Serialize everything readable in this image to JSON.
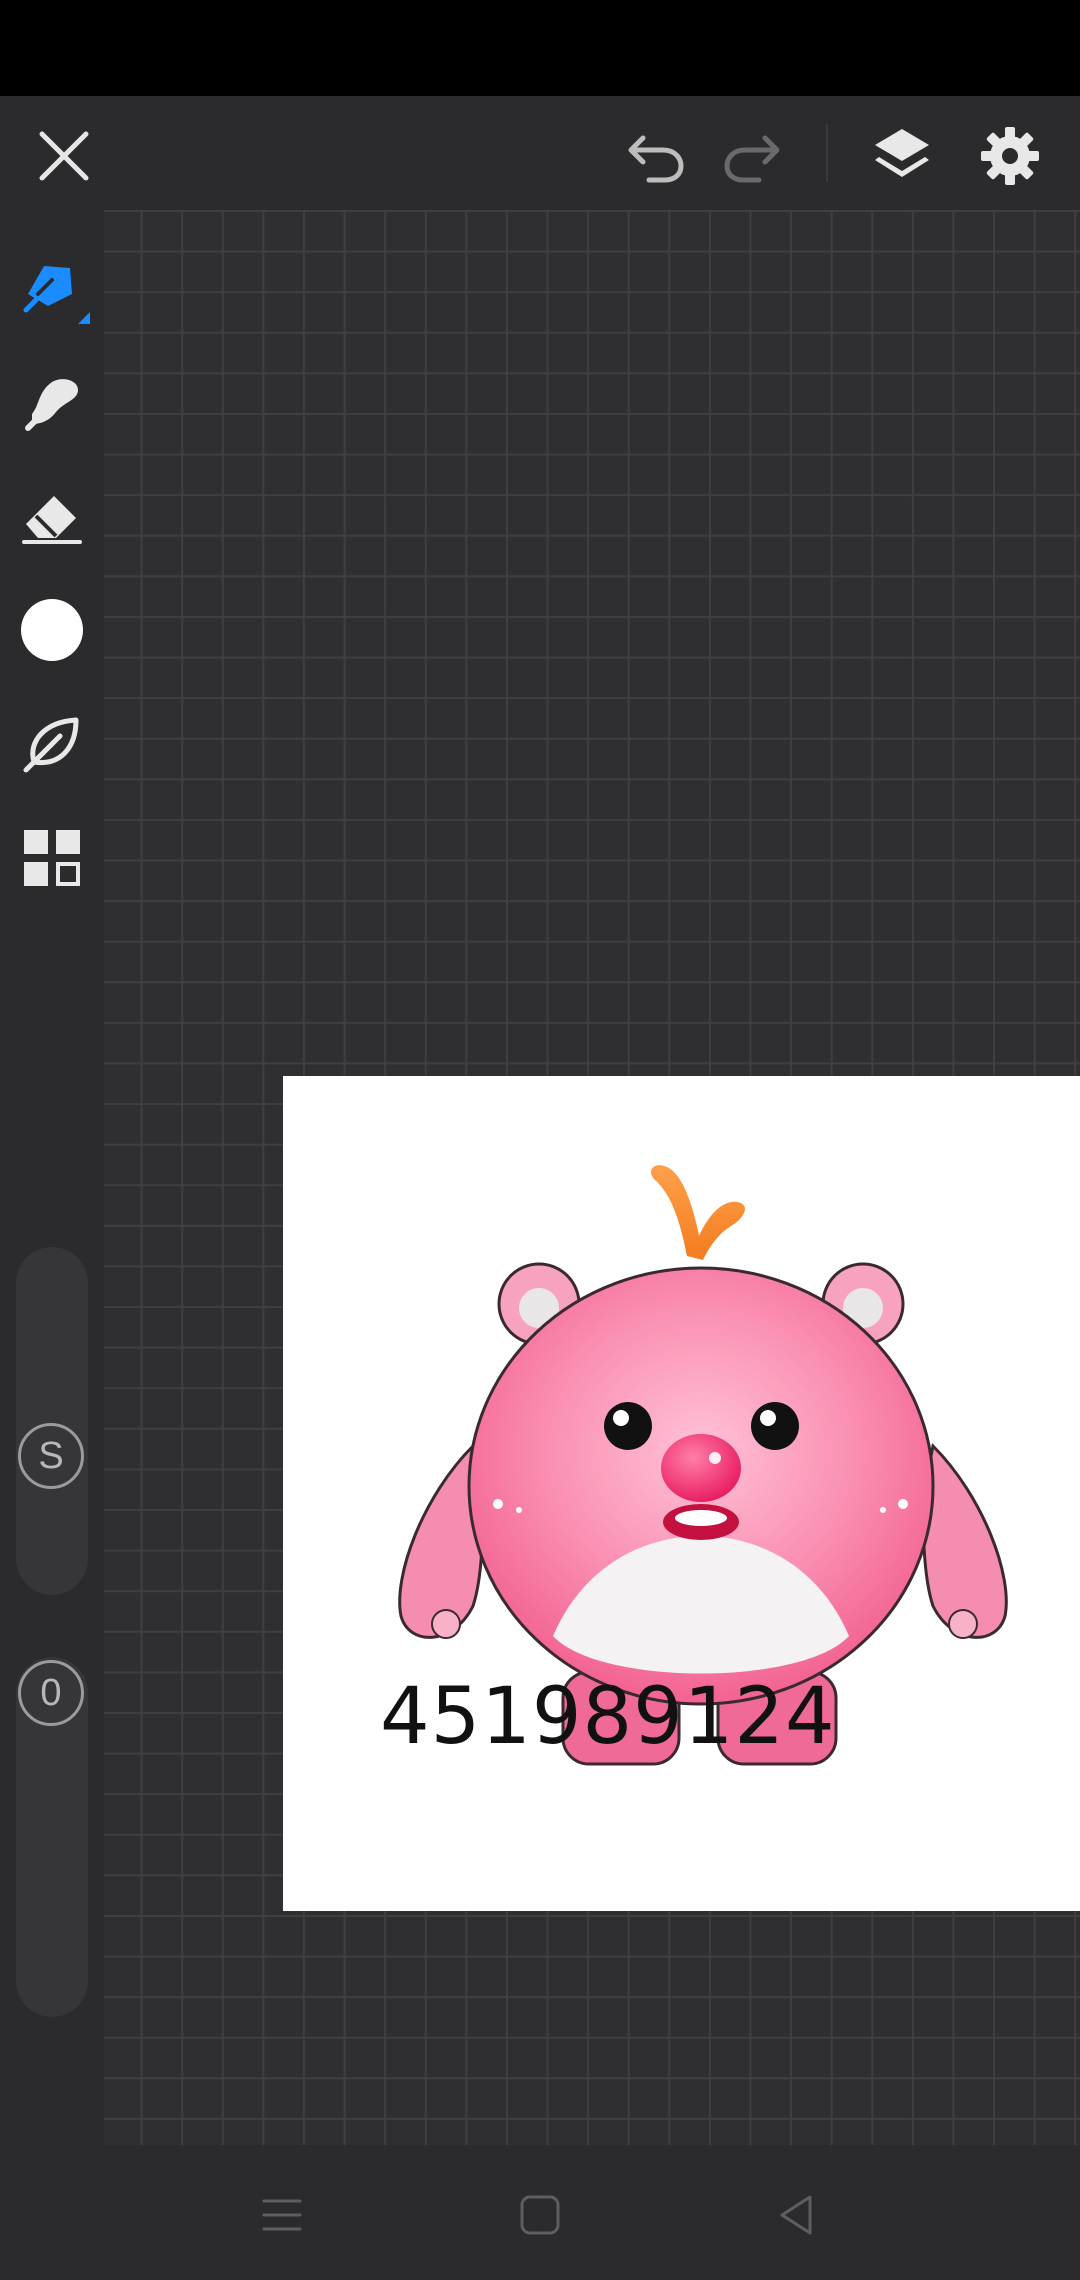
{
  "toolbar": {
    "close_icon": "close-icon",
    "undo_icon": "undo-icon",
    "redo_icon": "redo-icon",
    "layers_icon": "layers-icon",
    "settings_icon": "gear-icon"
  },
  "tools": [
    {
      "name": "pen",
      "icon": "pen-icon",
      "active": true
    },
    {
      "name": "smudge",
      "icon": "smudge-icon"
    },
    {
      "name": "eraser",
      "icon": "eraser-icon"
    },
    {
      "name": "color",
      "icon": "color-swatch",
      "color": "#ffffff"
    },
    {
      "name": "lasso",
      "icon": "leaf-lasso-icon"
    },
    {
      "name": "grid",
      "icon": "grid-icon"
    }
  ],
  "sliders": {
    "size_badge": "S",
    "opacity_badge": "0"
  },
  "canvas": {
    "overlay_text": "451989124"
  },
  "colors": {
    "accent": "#1a8cff",
    "toolbar_bg": "#2b2b2d",
    "canvas_bg": "#2f2f31"
  }
}
